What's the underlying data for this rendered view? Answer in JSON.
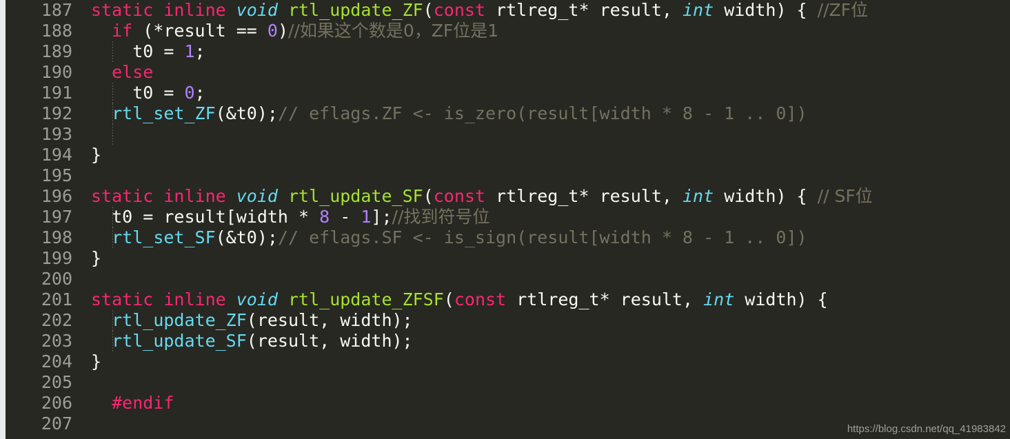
{
  "editor": {
    "theme_name": "monokai",
    "background_color": "#272822",
    "gutter_strip_color": "#eaebec",
    "line_number_color": "#9d9d94",
    "first_line_number": 187,
    "last_line_number": 207,
    "colors": {
      "keyword": "#f92672",
      "type": "#66d9ef",
      "function_definition": "#a6e22e",
      "function_call": "#66d9ef",
      "number": "#ae81ff",
      "comment": "#75715e",
      "plain": "#f8f8f2"
    },
    "line_numbers": [
      "187",
      "188",
      "189",
      "190",
      "191",
      "192",
      "193",
      "194",
      "195",
      "196",
      "197",
      "198",
      "199",
      "200",
      "201",
      "202",
      "203",
      "204",
      "205",
      "206",
      "207"
    ],
    "lines": [
      {
        "n": "187",
        "indent_guides": 0,
        "tokens": [
          {
            "t": "static inline ",
            "c": "kw"
          },
          {
            "t": "void",
            "c": "typ"
          },
          {
            "t": " ",
            "c": "pln"
          },
          {
            "t": "rtl_update_ZF",
            "c": "fnd"
          },
          {
            "t": "(",
            "c": "pln"
          },
          {
            "t": "const",
            "c": "kw"
          },
          {
            "t": " rtlreg_t* result, ",
            "c": "pln"
          },
          {
            "t": "int",
            "c": "typ"
          },
          {
            "t": " width) { ",
            "c": "pln"
          },
          {
            "t": "//ZF位",
            "c": "cmt"
          }
        ]
      },
      {
        "n": "188",
        "indent_guides": 0,
        "tokens": [
          {
            "t": "  ",
            "c": "pln"
          },
          {
            "t": "if",
            "c": "kw"
          },
          {
            "t": " (*result == ",
            "c": "pln"
          },
          {
            "t": "0",
            "c": "num"
          },
          {
            "t": ")",
            "c": "pln"
          },
          {
            "t": "//如果这个数是0，ZF位是1",
            "c": "cmt"
          }
        ]
      },
      {
        "n": "189",
        "indent_guides": 1,
        "tokens": [
          {
            "t": "    t0 = ",
            "c": "pln"
          },
          {
            "t": "1",
            "c": "num"
          },
          {
            "t": ";",
            "c": "pln"
          }
        ]
      },
      {
        "n": "190",
        "indent_guides": 0,
        "tokens": [
          {
            "t": "  ",
            "c": "pln"
          },
          {
            "t": "else",
            "c": "kw"
          }
        ]
      },
      {
        "n": "191",
        "indent_guides": 1,
        "tokens": [
          {
            "t": "    t0 = ",
            "c": "pln"
          },
          {
            "t": "0",
            "c": "num"
          },
          {
            "t": ";",
            "c": "pln"
          }
        ]
      },
      {
        "n": "192",
        "indent_guides": 1,
        "tokens": [
          {
            "t": "  ",
            "c": "pln"
          },
          {
            "t": "rtl_set_ZF",
            "c": "fnc"
          },
          {
            "t": "(&t0);",
            "c": "pln"
          },
          {
            "t": "// eflags.ZF <- is_zero(result[width * 8 - 1 .. 0])",
            "c": "cmt"
          }
        ]
      },
      {
        "n": "193",
        "indent_guides": 1,
        "tokens": []
      },
      {
        "n": "194",
        "indent_guides": 0,
        "tokens": [
          {
            "t": "}",
            "c": "pln"
          }
        ]
      },
      {
        "n": "195",
        "indent_guides": 0,
        "tokens": []
      },
      {
        "n": "196",
        "indent_guides": 0,
        "tokens": [
          {
            "t": "static inline ",
            "c": "kw"
          },
          {
            "t": "void",
            "c": "typ"
          },
          {
            "t": " ",
            "c": "pln"
          },
          {
            "t": "rtl_update_SF",
            "c": "fnd"
          },
          {
            "t": "(",
            "c": "pln"
          },
          {
            "t": "const",
            "c": "kw"
          },
          {
            "t": " rtlreg_t* result, ",
            "c": "pln"
          },
          {
            "t": "int",
            "c": "typ"
          },
          {
            "t": " width) { ",
            "c": "pln"
          },
          {
            "t": "// SF位",
            "c": "cmt"
          }
        ]
      },
      {
        "n": "197",
        "indent_guides": 1,
        "tokens": [
          {
            "t": "  t0 = result[width * ",
            "c": "pln"
          },
          {
            "t": "8",
            "c": "num"
          },
          {
            "t": " - ",
            "c": "pln"
          },
          {
            "t": "1",
            "c": "num"
          },
          {
            "t": "];",
            "c": "pln"
          },
          {
            "t": "//找到符号位",
            "c": "cmt"
          }
        ]
      },
      {
        "n": "198",
        "indent_guides": 1,
        "tokens": [
          {
            "t": "  ",
            "c": "pln"
          },
          {
            "t": "rtl_set_SF",
            "c": "fnc"
          },
          {
            "t": "(&t0);",
            "c": "pln"
          },
          {
            "t": "// eflags.SF <- is_sign(result[width * 8 - 1 .. 0])",
            "c": "cmt"
          }
        ]
      },
      {
        "n": "199",
        "indent_guides": 0,
        "tokens": [
          {
            "t": "}",
            "c": "pln"
          }
        ]
      },
      {
        "n": "200",
        "indent_guides": 0,
        "tokens": []
      },
      {
        "n": "201",
        "indent_guides": 0,
        "tokens": [
          {
            "t": "static inline ",
            "c": "kw"
          },
          {
            "t": "void",
            "c": "typ"
          },
          {
            "t": " ",
            "c": "pln"
          },
          {
            "t": "rtl_update_ZFSF",
            "c": "fnd"
          },
          {
            "t": "(",
            "c": "pln"
          },
          {
            "t": "const",
            "c": "kw"
          },
          {
            "t": " rtlreg_t* result, ",
            "c": "pln"
          },
          {
            "t": "int",
            "c": "typ"
          },
          {
            "t": " width) {",
            "c": "pln"
          }
        ]
      },
      {
        "n": "202",
        "indent_guides": 1,
        "tokens": [
          {
            "t": "  ",
            "c": "pln"
          },
          {
            "t": "rtl_update_ZF",
            "c": "fnc"
          },
          {
            "t": "(result, width);",
            "c": "pln"
          }
        ]
      },
      {
        "n": "203",
        "indent_guides": 1,
        "tokens": [
          {
            "t": "  ",
            "c": "pln"
          },
          {
            "t": "rtl_update_SF",
            "c": "fnc"
          },
          {
            "t": "(result, width);",
            "c": "pln"
          }
        ]
      },
      {
        "n": "204",
        "indent_guides": 0,
        "tokens": [
          {
            "t": "}",
            "c": "pln"
          }
        ]
      },
      {
        "n": "205",
        "indent_guides": 0,
        "tokens": []
      },
      {
        "n": "206",
        "indent_guides": 0,
        "tokens": [
          {
            "t": "  ",
            "c": "pln"
          },
          {
            "t": "#endif",
            "c": "kw"
          }
        ]
      },
      {
        "n": "207",
        "indent_guides": 0,
        "tokens": []
      }
    ]
  },
  "watermark": {
    "text": "https://blog.csdn.net/qq_41983842"
  }
}
